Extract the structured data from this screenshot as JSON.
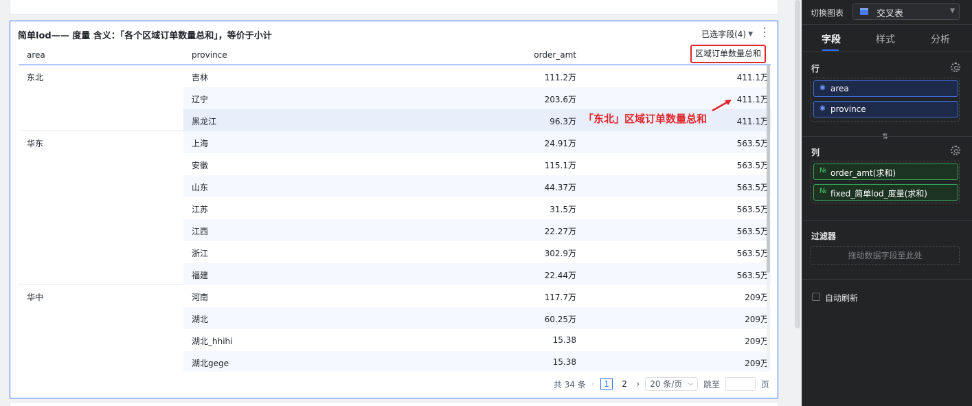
{
  "card": {
    "title": "简单lod—— 度量 含义：「各个区域订单数量总和」，等价于小计",
    "field_select": "已选字段(4)"
  },
  "table": {
    "columns": [
      "area",
      "province",
      "order_amt",
      "区域订单数量总和"
    ],
    "rows": [
      {
        "province": "吉林",
        "order_amt": "111.2万",
        "total": "411.1万"
      },
      {
        "province": "辽宁",
        "order_amt": "203.6万",
        "total": "411.1万"
      },
      {
        "province": "黑龙江",
        "order_amt": "96.3万",
        "total": "411.1万"
      },
      {
        "province": "上海",
        "order_amt": "24.91万",
        "total": "563.5万"
      },
      {
        "province": "安徽",
        "order_amt": "115.1万",
        "total": "563.5万"
      },
      {
        "province": "山东",
        "order_amt": "44.37万",
        "total": "563.5万"
      },
      {
        "province": "江苏",
        "order_amt": "31.5万",
        "total": "563.5万"
      },
      {
        "province": "江西",
        "order_amt": "22.27万",
        "total": "563.5万"
      },
      {
        "province": "浙江",
        "order_amt": "302.9万",
        "total": "563.5万"
      },
      {
        "province": "福建",
        "order_amt": "22.44万",
        "total": "563.5万"
      },
      {
        "province": "河南",
        "order_amt": "117.7万",
        "total": "209万"
      },
      {
        "province": "湖北",
        "order_amt": "60.25万",
        "total": "209万"
      },
      {
        "province": "湖北_hhihi",
        "order_amt": "15.38",
        "total": "209万"
      },
      {
        "province": "湖北gege",
        "order_amt": "15.38",
        "total": "209万"
      }
    ],
    "areas": [
      {
        "name": "东北",
        "row_count": 3
      },
      {
        "name": "华东",
        "row_count": 7
      },
      {
        "name": "华中",
        "row_count": 4
      }
    ]
  },
  "annotation": "「东北」区域订单数量总和",
  "pager": {
    "total": "共 34 条",
    "prev": "‹",
    "page1": "1",
    "page2": "2",
    "next": "›",
    "page_size": "20 条/页",
    "jump_label": "跳至",
    "page_unit": "页"
  },
  "panel": {
    "switch_label": "切换图表",
    "chart_type": "交叉表",
    "tabs": [
      "字段",
      "样式",
      "分析"
    ],
    "rows_title": "行",
    "row_fields": [
      "area",
      "province"
    ],
    "cols_title": "列",
    "col_fields": [
      "order_amt(求和)",
      "fixed_简单lod_度量(求和)"
    ],
    "filter_title": "过滤器",
    "filter_hint": "拖动数据字段至此处",
    "auto_refresh": "自动刷新"
  },
  "colors": {
    "accent": "#3370ff",
    "highlight_red": "#e0262a"
  }
}
